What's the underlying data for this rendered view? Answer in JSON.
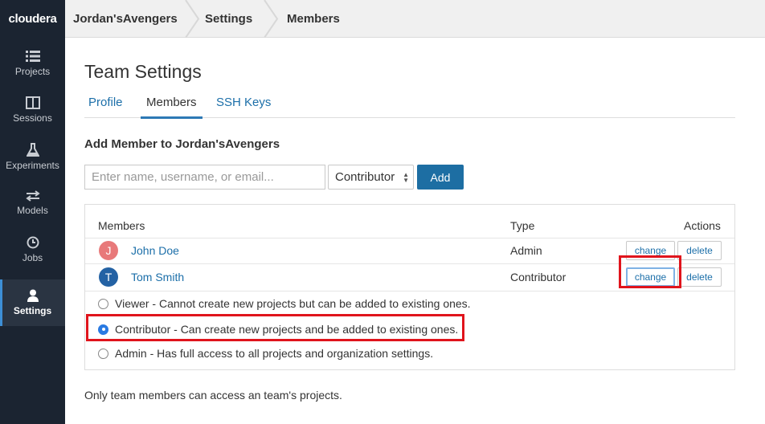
{
  "sidebar": {
    "logo": "cloudera",
    "items": [
      {
        "label": "Projects",
        "icon": "list-icon"
      },
      {
        "label": "Sessions",
        "icon": "window-icon"
      },
      {
        "label": "Experiments",
        "icon": "flask-icon"
      },
      {
        "label": "Models",
        "icon": "arrows-icon"
      },
      {
        "label": "Jobs",
        "icon": "clock-icon"
      },
      {
        "label": "Settings",
        "icon": "user-icon",
        "active": true
      }
    ]
  },
  "breadcrumb": [
    "Jordan'sAvengers",
    "Settings",
    "Members"
  ],
  "page": {
    "title": "Team Settings",
    "tabs": [
      {
        "label": "Profile"
      },
      {
        "label": "Members",
        "active": true
      },
      {
        "label": "SSH Keys"
      }
    ]
  },
  "add_member": {
    "title": "Add Member to Jordan'sAvengers",
    "search_placeholder": "Enter name, username, or email...",
    "role_selected": "Contributor",
    "add_label": "Add"
  },
  "members_table": {
    "headers": {
      "members": "Members",
      "type": "Type",
      "actions": "Actions"
    },
    "rows": [
      {
        "initial": "J",
        "name": "John Doe",
        "type": "Admin",
        "avatar_color": "#e8797a",
        "change_label": "change",
        "delete_label": "delete"
      },
      {
        "initial": "T",
        "name": "Tom Smith",
        "type": "Contributor",
        "avatar_color": "#2462a4",
        "change_label": "change",
        "delete_label": "delete"
      }
    ],
    "role_options": [
      {
        "label": "Viewer - Cannot create new projects but can be added to existing ones.",
        "checked": false
      },
      {
        "label": "Contributor - Can create new projects and be added to existing ones.",
        "checked": true
      },
      {
        "label": "Admin - Has full access to all projects and organization settings.",
        "checked": false
      }
    ]
  },
  "footer_note": "Only team members can access an team's projects.",
  "colors": {
    "sidebar_bg": "#1b2431",
    "accent": "#1d6ea3",
    "highlight": "#e0141c"
  }
}
